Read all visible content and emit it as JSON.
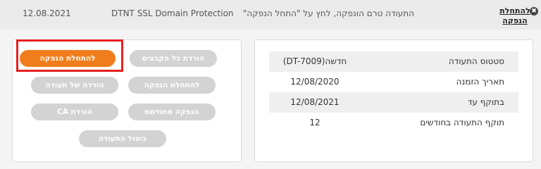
{
  "topbar": {
    "date": "12.08.2021",
    "product": "DTNT SSL Domain Protection",
    "status": "התעודה טרם הונפקה, לחץ על \"התחל הנפקה\"",
    "start_link": "להתחלת הנפקה",
    "close_glyph": "✖"
  },
  "details": {
    "rows": [
      {
        "label": "סטטוס התעודה",
        "value": "(DT-7009)חדשה"
      },
      {
        "label": "תאריך הזמנה",
        "value": "12/08/2020"
      },
      {
        "label": "בתוקף עד",
        "value": "12/08/2021"
      },
      {
        "label": "תוקף התעודה בחודשים",
        "value": "12"
      }
    ]
  },
  "actions": {
    "start_issuance_primary": "להתחלת הנפקה",
    "download_all_files": "הורדת כל הקבצים",
    "download_certificate": "הורדה של תעודה",
    "start_issuance": "להתחלת הנפקה",
    "download_ca": "הורדת CA",
    "reissue": "הנפקה מחודשת",
    "cancel_certificate": "ביטול התעודה"
  },
  "colors": {
    "primary": "#f07d1c",
    "disabled": "#d3d3d3",
    "highlight": "#e62020"
  }
}
